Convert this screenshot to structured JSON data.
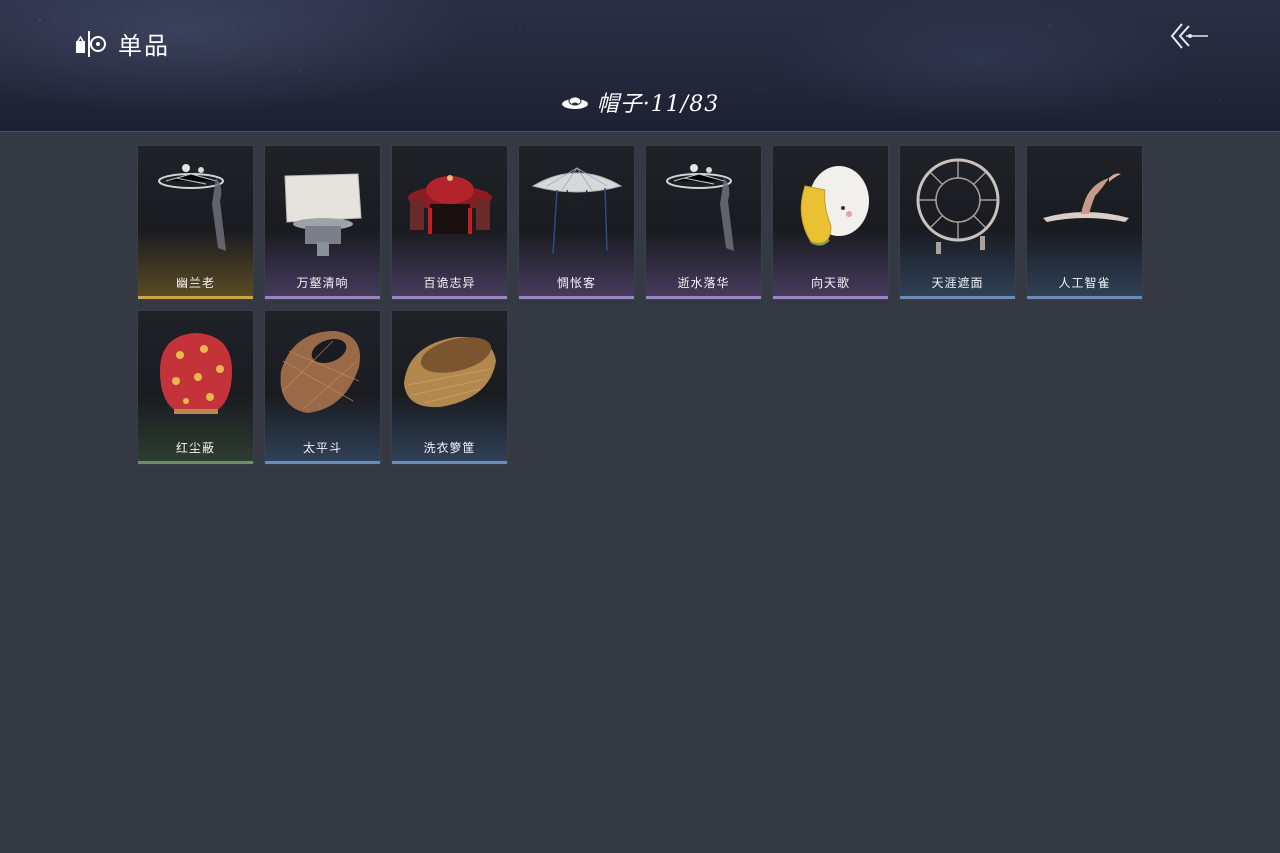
{
  "header": {
    "title": "单品",
    "title_icon": "wardrobe-icon",
    "back_icon": "back-arrow-icon"
  },
  "category": {
    "icon": "hat-icon",
    "title": "帽子·11/83"
  },
  "items": [
    {
      "name": "幽兰老",
      "rarity": "gold",
      "icon": "ornate-veil-hat"
    },
    {
      "name": "万壑清响",
      "rarity": "purple",
      "icon": "white-square-crown"
    },
    {
      "name": "百诡志异",
      "rarity": "purple",
      "icon": "red-tassel-hat"
    },
    {
      "name": "惆怅客",
      "rarity": "purple",
      "icon": "straw-conical-hat"
    },
    {
      "name": "逝水落华",
      "rarity": "purple",
      "icon": "ornate-veil-hat"
    },
    {
      "name": "向天歌",
      "rarity": "purple",
      "icon": "duck-hood"
    },
    {
      "name": "天涯遮面",
      "rarity": "blue",
      "icon": "wheel-hat"
    },
    {
      "name": "人工智雀",
      "rarity": "blue",
      "icon": "bird-hat"
    },
    {
      "name": "红尘蔽",
      "rarity": "green",
      "icon": "red-head-cover"
    },
    {
      "name": "太平斗",
      "rarity": "blue",
      "icon": "wicker-basket-hat"
    },
    {
      "name": "洗衣箩筐",
      "rarity": "blue",
      "icon": "laundry-basket"
    }
  ],
  "colors": {
    "background": "#353943",
    "gold": "#c9a54b",
    "purple": "#9a86c4",
    "blue": "#6a8cb8",
    "green": "#6f8f6a"
  }
}
